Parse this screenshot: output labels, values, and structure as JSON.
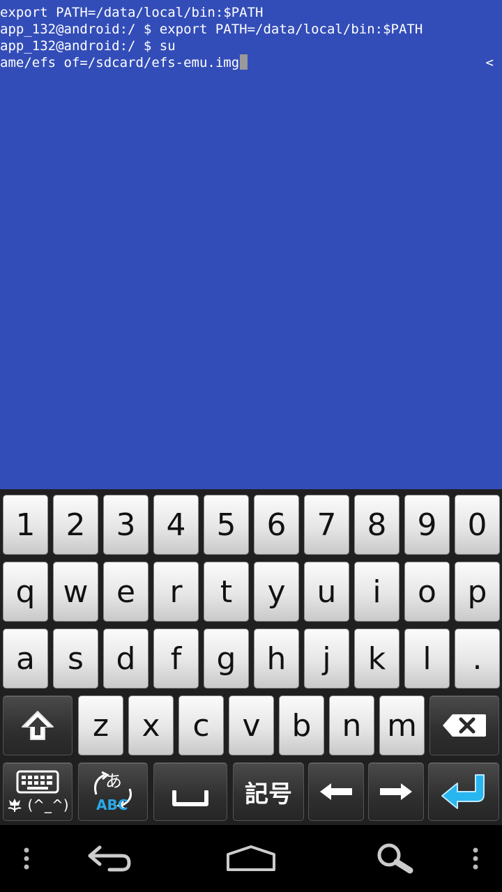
{
  "terminal": {
    "lines": [
      "export PATH=/data/local/bin:$PATH",
      "app_132@android:/ $ export PATH=/data/local/bin:$PATH",
      "app_132@android:/ $ su",
      "ame/efs of=/sdcard/efs-emu.img"
    ],
    "scroll_indicator": "<",
    "colors": {
      "background": "#334db8",
      "text": "#ffffff",
      "cursor": "#9a9a9a"
    }
  },
  "keyboard": {
    "row_numbers": [
      "1",
      "2",
      "3",
      "4",
      "5",
      "6",
      "7",
      "8",
      "9",
      "0"
    ],
    "row_top": [
      "q",
      "w",
      "e",
      "r",
      "t",
      "y",
      "u",
      "i",
      "o",
      "p"
    ],
    "row_middle": [
      "a",
      "s",
      "d",
      "f",
      "g",
      "h",
      "j",
      "k",
      "l",
      "."
    ],
    "row_bottom": [
      "z",
      "x",
      "c",
      "v",
      "b",
      "n",
      "m"
    ],
    "special": {
      "shift_icon": "shift-up-arrow-icon",
      "backspace_icon": "backspace-icon",
      "keyboard_settings_icon": "keyboard-icon",
      "emoticon_label": "(^_^)",
      "mode_kana": "あ",
      "mode_abc": "ABC",
      "space_icon": "space-icon",
      "symbols_label": "記号",
      "left_arrow_icon": "left-arrow-icon",
      "right_arrow_icon": "right-arrow-icon",
      "enter_icon": "enter-icon"
    },
    "colors": {
      "abc_blue": "#2aa8e8",
      "enter_blue": "#27b6f0"
    }
  },
  "navbar": {
    "icons": [
      "menu-dots-icon",
      "back-icon",
      "home-icon",
      "search-icon",
      "overflow-dots-icon"
    ]
  }
}
